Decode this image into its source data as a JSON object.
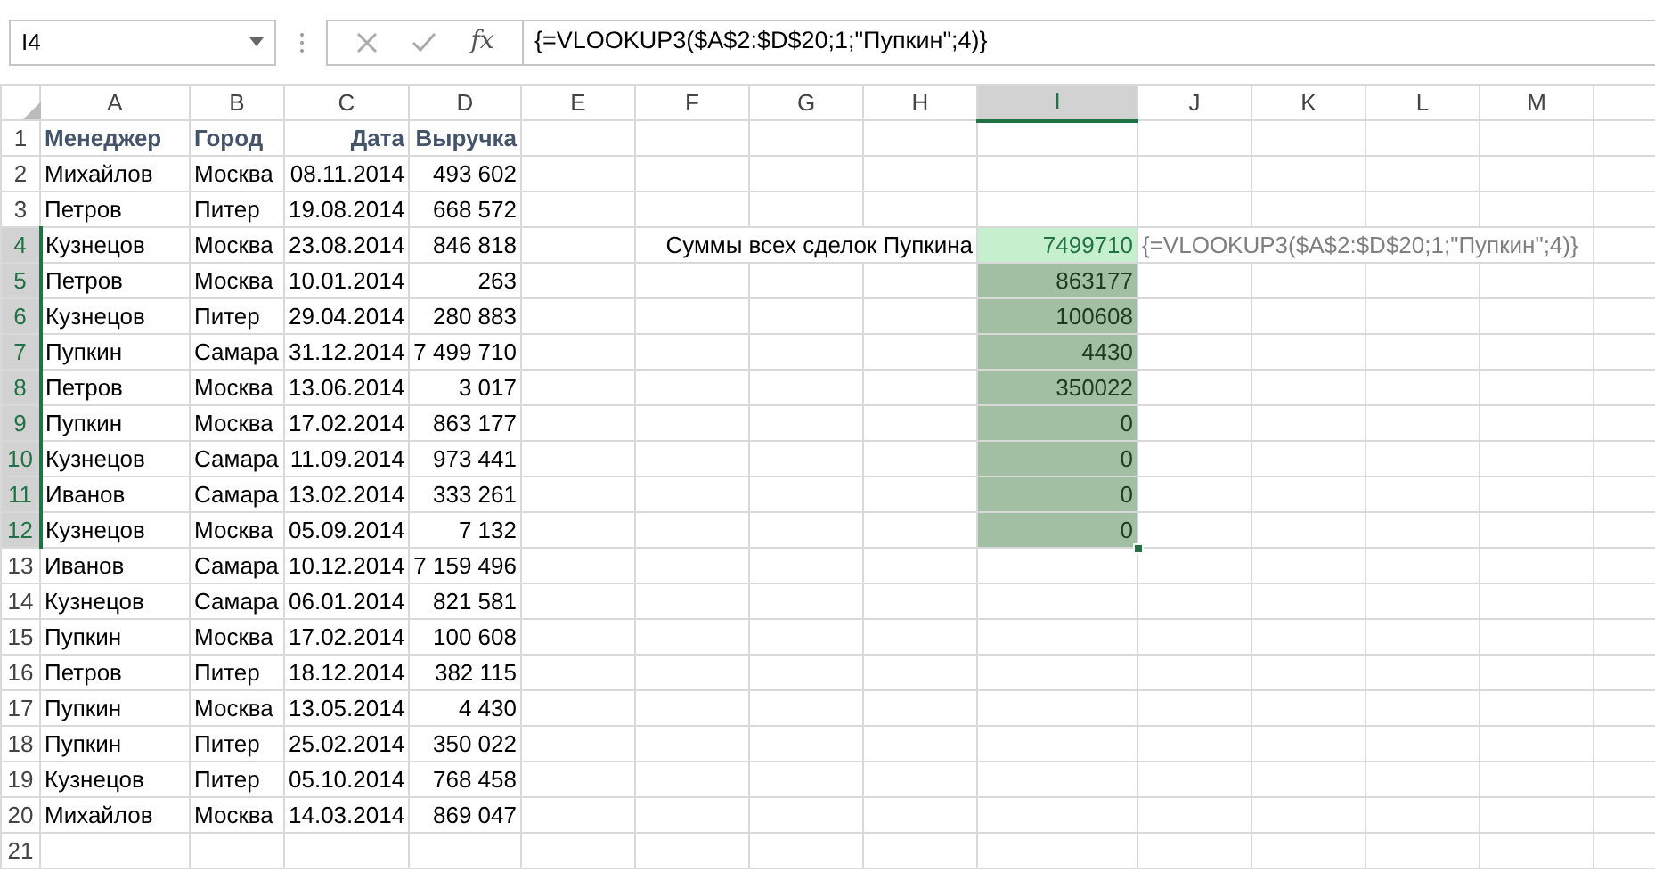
{
  "formula_bar": {
    "name_box": "I4",
    "function_label": "fx",
    "formula": "{=VLOOKUP3($A$2:$D$20;1;\"Пупкин\";4)}"
  },
  "columns": [
    {
      "label": "A",
      "selected": false
    },
    {
      "label": "B",
      "selected": false
    },
    {
      "label": "C",
      "selected": false
    },
    {
      "label": "D",
      "selected": false
    },
    {
      "label": "E",
      "selected": false
    },
    {
      "label": "F",
      "selected": false
    },
    {
      "label": "G",
      "selected": false
    },
    {
      "label": "H",
      "selected": false
    },
    {
      "label": "I",
      "selected": true
    },
    {
      "label": "J",
      "selected": false
    },
    {
      "label": "K",
      "selected": false
    },
    {
      "label": "L",
      "selected": false
    },
    {
      "label": "M",
      "selected": false
    }
  ],
  "rows": [
    {
      "header": "1",
      "selected": false,
      "kind": "header",
      "cells": [
        "Менеджер",
        "Город",
        "Дата",
        "Выручка"
      ]
    },
    {
      "header": "2",
      "selected": false,
      "kind": "data",
      "cells": [
        "Михайлов",
        "Москва",
        "08.11.2014",
        "493 602"
      ]
    },
    {
      "header": "3",
      "selected": false,
      "kind": "data",
      "cells": [
        "Петров",
        "Питер",
        "19.08.2014",
        "668 572"
      ]
    },
    {
      "header": "4",
      "selected": true,
      "kind": "data",
      "cells": [
        "Кузнецов",
        "Москва",
        "23.08.2014",
        "846 818"
      ]
    },
    {
      "header": "5",
      "selected": true,
      "kind": "data",
      "cells": [
        "Петров",
        "Москва",
        "10.01.2014",
        "263"
      ]
    },
    {
      "header": "6",
      "selected": true,
      "kind": "data",
      "cells": [
        "Кузнецов",
        "Питер",
        "29.04.2014",
        "280 883"
      ]
    },
    {
      "header": "7",
      "selected": true,
      "kind": "data",
      "cells": [
        "Пупкин",
        "Самара",
        "31.12.2014",
        "7 499 710"
      ]
    },
    {
      "header": "8",
      "selected": true,
      "kind": "data",
      "cells": [
        "Петров",
        "Москва",
        "13.06.2014",
        "3 017"
      ]
    },
    {
      "header": "9",
      "selected": true,
      "kind": "data",
      "cells": [
        "Пупкин",
        "Москва",
        "17.02.2014",
        "863 177"
      ]
    },
    {
      "header": "10",
      "selected": true,
      "kind": "data",
      "cells": [
        "Кузнецов",
        "Самара",
        "11.09.2014",
        "973 441"
      ]
    },
    {
      "header": "11",
      "selected": true,
      "kind": "data",
      "cells": [
        "Иванов",
        "Самара",
        "13.02.2014",
        "333 261"
      ]
    },
    {
      "header": "12",
      "selected": true,
      "kind": "data",
      "cells": [
        "Кузнецов",
        "Москва",
        "05.09.2014",
        "7 132"
      ]
    },
    {
      "header": "13",
      "selected": false,
      "kind": "data",
      "cells": [
        "Иванов",
        "Самара",
        "10.12.2014",
        "7 159 496"
      ]
    },
    {
      "header": "14",
      "selected": false,
      "kind": "data",
      "cells": [
        "Кузнецов",
        "Самара",
        "06.01.2014",
        "821 581"
      ]
    },
    {
      "header": "15",
      "selected": false,
      "kind": "data",
      "cells": [
        "Пупкин",
        "Москва",
        "17.02.2014",
        "100 608"
      ]
    },
    {
      "header": "16",
      "selected": false,
      "kind": "data",
      "cells": [
        "Петров",
        "Питер",
        "18.12.2014",
        "382 115"
      ]
    },
    {
      "header": "17",
      "selected": false,
      "kind": "data",
      "cells": [
        "Пупкин",
        "Москва",
        "13.05.2014",
        "4 430"
      ]
    },
    {
      "header": "18",
      "selected": false,
      "kind": "data",
      "cells": [
        "Пупкин",
        "Питер",
        "25.02.2014",
        "350 022"
      ]
    },
    {
      "header": "19",
      "selected": false,
      "kind": "data",
      "cells": [
        "Кузнецов",
        "Питер",
        "05.10.2014",
        "768 458"
      ]
    },
    {
      "header": "20",
      "selected": false,
      "kind": "data",
      "cells": [
        "Михайлов",
        "Москва",
        "14.03.2014",
        "869 047"
      ]
    },
    {
      "header": "21",
      "selected": false,
      "cells": []
    }
  ],
  "summary": {
    "label": "Суммы всех сделок Пупкина",
    "formula_note": "{=VLOOKUP3($A$2:$D$20;1;\"Пупкин\";4)}",
    "results": [
      {
        "value": "7499710",
        "selected": true,
        "active": true
      },
      {
        "value": "863177",
        "selected": true,
        "active": false
      },
      {
        "value": "100608",
        "selected": true,
        "active": false
      },
      {
        "value": "4430",
        "selected": true,
        "active": false
      },
      {
        "value": "350022",
        "selected": true,
        "active": false
      },
      {
        "value": "0",
        "selected": true,
        "active": false
      },
      {
        "value": "0",
        "selected": true,
        "active": false
      },
      {
        "value": "0",
        "selected": true,
        "active": false
      },
      {
        "value": "0",
        "selected": true,
        "active": false
      }
    ]
  }
}
